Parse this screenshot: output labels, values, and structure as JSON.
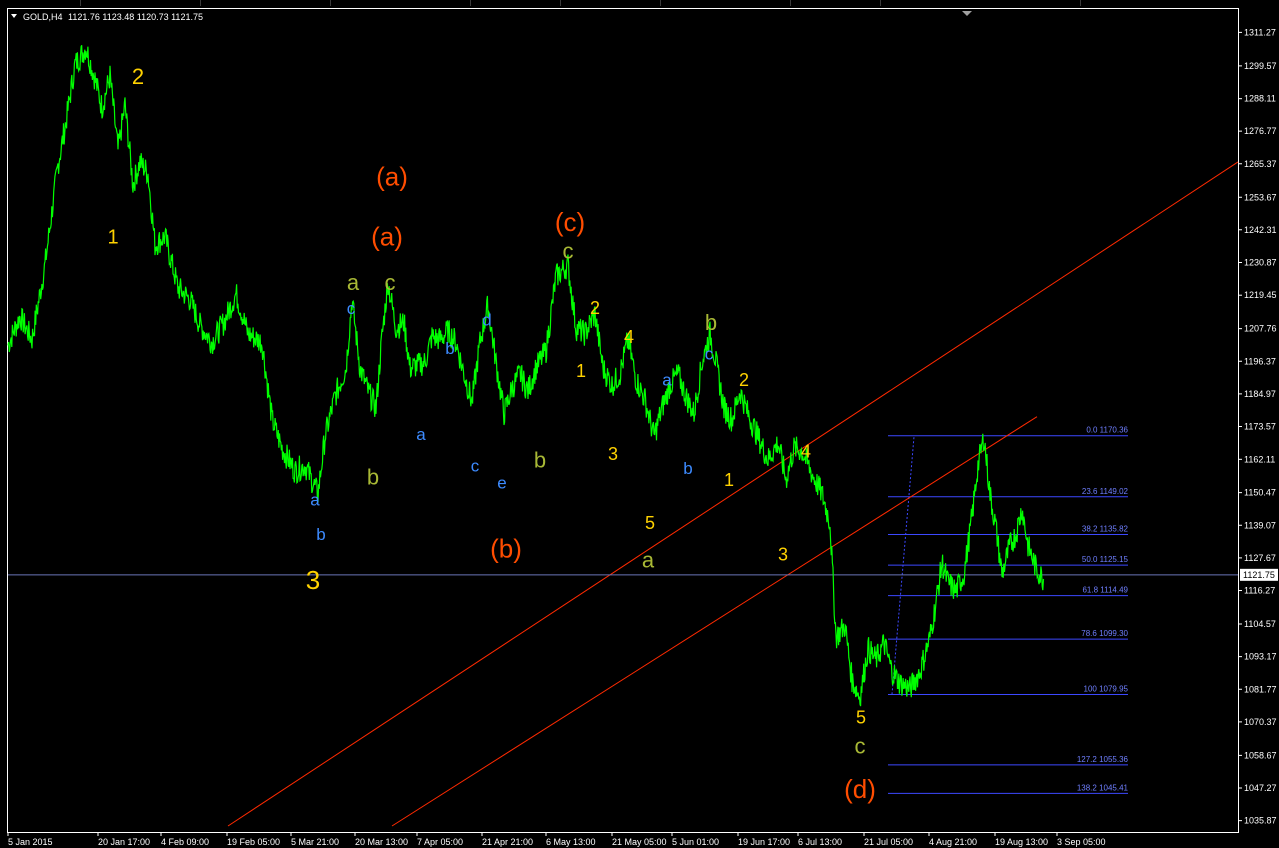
{
  "window": {
    "ticker_label": "GOLD,H4",
    "ohlc": "1121.76 1123.48 1120.73 1121.75",
    "current_price": "1121.75"
  },
  "colors": {
    "background": "#000000",
    "price_line": "#00ff00",
    "channel_line": "#ff2a00",
    "fib_line": "#3c48ff",
    "bid_line": "#6a75b8",
    "wave_yellow": "#ffd200",
    "wave_orange": "#ff4d00",
    "wave_olive": "#a8b835",
    "wave_blue": "#3d8bff"
  },
  "chart_data": {
    "type": "line",
    "instrument": "GOLD",
    "timeframe": "H4",
    "ylim": [
      1031.0,
      1316.0
    ],
    "xlim": [
      0,
      1232
    ],
    "y_ticks": [
      "1311.27",
      "1299.57",
      "1288.11",
      "1276.77",
      "1265.37",
      "1253.67",
      "1242.31",
      "1230.87",
      "1219.45",
      "1207.76",
      "1196.37",
      "1184.97",
      "1173.57",
      "1162.11",
      "1150.47",
      "1139.07",
      "1127.67",
      "1116.27",
      "1104.57",
      "1093.17",
      "1081.77",
      "1070.37",
      "1058.67",
      "1047.27",
      "1035.87"
    ],
    "x_ticks": [
      {
        "label": "5 Jan 2015",
        "x": 8
      },
      {
        "label": "20 Jan 17:00",
        "x": 98
      },
      {
        "label": "4 Feb 09:00",
        "x": 161
      },
      {
        "label": "19 Feb 05:00",
        "x": 227
      },
      {
        "label": "5 Mar 21:00",
        "x": 291
      },
      {
        "label": "20 Mar 13:00",
        "x": 355
      },
      {
        "label": "7 Apr 05:00",
        "x": 417
      },
      {
        "label": "21 Apr 21:00",
        "x": 482
      },
      {
        "label": "6 May 13:00",
        "x": 546
      },
      {
        "label": "21 May 05:00",
        "x": 612
      },
      {
        "label": "5 Jun 01:00",
        "x": 672
      },
      {
        "label": "19 Jun 17:00",
        "x": 738
      },
      {
        "label": "6 Jul 13:00",
        "x": 798
      },
      {
        "label": "21 Jul 05:00",
        "x": 864
      },
      {
        "label": "4 Aug 21:00",
        "x": 929
      },
      {
        "label": "19 Aug 13:00",
        "x": 995
      },
      {
        "label": "3 Sep 05:00",
        "x": 1057
      }
    ],
    "series": [
      {
        "points": [
          [
            8,
            1202
          ],
          [
            20,
            1212
          ],
          [
            32,
            1204
          ],
          [
            45,
            1230
          ],
          [
            58,
            1265
          ],
          [
            66,
            1280
          ],
          [
            75,
            1300
          ],
          [
            86,
            1306
          ],
          [
            95,
            1295
          ],
          [
            102,
            1285
          ],
          [
            110,
            1296
          ],
          [
            118,
            1270
          ],
          [
            125,
            1286
          ],
          [
            133,
            1258
          ],
          [
            140,
            1266
          ],
          [
            148,
            1262
          ],
          [
            155,
            1237
          ],
          [
            165,
            1240
          ],
          [
            178,
            1222
          ],
          [
            190,
            1218
          ],
          [
            200,
            1209
          ],
          [
            212,
            1203
          ],
          [
            224,
            1210
          ],
          [
            236,
            1220
          ],
          [
            248,
            1206
          ],
          [
            262,
            1203
          ],
          [
            272,
            1176
          ],
          [
            282,
            1166
          ],
          [
            295,
            1158
          ],
          [
            305,
            1160
          ],
          [
            318,
            1150
          ],
          [
            325,
            1170
          ],
          [
            335,
            1184
          ],
          [
            346,
            1194
          ],
          [
            352,
            1218
          ],
          [
            360,
            1194
          ],
          [
            368,
            1186
          ],
          [
            376,
            1180
          ],
          [
            382,
            1205
          ],
          [
            388,
            1224
          ],
          [
            396,
            1208
          ],
          [
            404,
            1210
          ],
          [
            410,
            1194
          ],
          [
            418,
            1195
          ],
          [
            425,
            1196
          ],
          [
            432,
            1205
          ],
          [
            440,
            1204
          ],
          [
            448,
            1207
          ],
          [
            456,
            1203
          ],
          [
            464,
            1192
          ],
          [
            472,
            1182
          ],
          [
            480,
            1203
          ],
          [
            488,
            1216
          ],
          [
            496,
            1196
          ],
          [
            504,
            1178
          ],
          [
            512,
            1187
          ],
          [
            520,
            1192
          ],
          [
            528,
            1186
          ],
          [
            536,
            1194
          ],
          [
            546,
            1200
          ],
          [
            556,
            1226
          ],
          [
            568,
            1230
          ],
          [
            576,
            1208
          ],
          [
            585,
            1206
          ],
          [
            595,
            1213
          ],
          [
            603,
            1194
          ],
          [
            612,
            1188
          ],
          [
            620,
            1192
          ],
          [
            628,
            1204
          ],
          [
            636,
            1190
          ],
          [
            645,
            1183
          ],
          [
            654,
            1170
          ],
          [
            662,
            1180
          ],
          [
            670,
            1188
          ],
          [
            678,
            1192
          ],
          [
            686,
            1184
          ],
          [
            694,
            1178
          ],
          [
            702,
            1196
          ],
          [
            710,
            1206
          ],
          [
            716,
            1196
          ],
          [
            724,
            1180
          ],
          [
            732,
            1176
          ],
          [
            740,
            1186
          ],
          [
            748,
            1178
          ],
          [
            758,
            1170
          ],
          [
            768,
            1162
          ],
          [
            778,
            1168
          ],
          [
            786,
            1155
          ],
          [
            794,
            1166
          ],
          [
            802,
            1165
          ],
          [
            812,
            1157
          ],
          [
            822,
            1150
          ],
          [
            830,
            1140
          ],
          [
            836,
            1100
          ],
          [
            845,
            1104
          ],
          [
            852,
            1085
          ],
          [
            860,
            1079
          ],
          [
            868,
            1096
          ],
          [
            876,
            1092
          ],
          [
            884,
            1098
          ],
          [
            892,
            1088
          ],
          [
            900,
            1084
          ],
          [
            910,
            1082
          ],
          [
            920,
            1088
          ],
          [
            930,
            1100
          ],
          [
            936,
            1112
          ],
          [
            942,
            1126
          ],
          [
            948,
            1119
          ],
          [
            956,
            1116
          ],
          [
            964,
            1122
          ],
          [
            972,
            1142
          ],
          [
            978,
            1160
          ],
          [
            984,
            1170
          ],
          [
            990,
            1150
          ],
          [
            996,
            1138
          ],
          [
            1002,
            1122
          ],
          [
            1010,
            1132
          ],
          [
            1016,
            1136
          ],
          [
            1022,
            1145
          ],
          [
            1028,
            1132
          ],
          [
            1036,
            1124
          ],
          [
            1044,
            1120
          ]
        ]
      }
    ],
    "channel_lines": [
      {
        "from": [
          228,
          1034
        ],
        "to": [
          1238,
          1266
        ]
      },
      {
        "from": [
          392,
          1034
        ],
        "to": [
          1037,
          1177
        ]
      }
    ],
    "fib_anchor_line": {
      "from": [
        892,
        1080
      ],
      "to": [
        914,
        1170
      ]
    },
    "fib_levels": [
      {
        "label": "0.0 1170.36",
        "price": 1170.36
      },
      {
        "label": "23.6 1149.02",
        "price": 1149.02
      },
      {
        "label": "38.2 1135.82",
        "price": 1135.82
      },
      {
        "label": "50.0 1125.15",
        "price": 1125.15
      },
      {
        "label": "61.8 1114.49",
        "price": 1114.49
      },
      {
        "label": "78.6 1099.30",
        "price": 1099.3
      },
      {
        "label": "100 1079.95",
        "price": 1079.95
      },
      {
        "label": "127.2 1055.36",
        "price": 1055.36
      },
      {
        "label": "138.2 1045.41",
        "price": 1045.41
      }
    ],
    "fib_x_range": [
      888,
      1128
    ],
    "bid_price": 1121.75,
    "annotations": [
      {
        "text": "2",
        "x": 138,
        "price": 1296,
        "color": "yellow",
        "size": 22
      },
      {
        "text": "1",
        "x": 113,
        "price": 1240,
        "color": "yellow",
        "size": 20
      },
      {
        "text": "(a)",
        "x": 392,
        "price": 1261,
        "color": "orange",
        "size": 26
      },
      {
        "text": "(a)",
        "x": 387,
        "price": 1240,
        "color": "orange",
        "size": 26
      },
      {
        "text": "a",
        "x": 353,
        "price": 1224,
        "color": "olive",
        "size": 22
      },
      {
        "text": "c",
        "x": 390,
        "price": 1224,
        "color": "olive",
        "size": 22
      },
      {
        "text": "c",
        "x": 351,
        "price": 1215,
        "color": "blue",
        "size": 17
      },
      {
        "text": "b",
        "x": 373,
        "price": 1156,
        "color": "olive",
        "size": 22
      },
      {
        "text": "a",
        "x": 315,
        "price": 1148,
        "color": "blue",
        "size": 17
      },
      {
        "text": "b",
        "x": 321,
        "price": 1136,
        "color": "blue",
        "size": 17
      },
      {
        "text": "3",
        "x": 313,
        "price": 1120,
        "color": "yellow",
        "size": 26
      },
      {
        "text": "a",
        "x": 421,
        "price": 1171,
        "color": "blue",
        "size": 17
      },
      {
        "text": "b",
        "x": 450,
        "price": 1201,
        "color": "blue",
        "size": 17
      },
      {
        "text": "d",
        "x": 487,
        "price": 1211,
        "color": "blue",
        "size": 17
      },
      {
        "text": "c",
        "x": 475,
        "price": 1160,
        "color": "blue",
        "size": 17
      },
      {
        "text": "e",
        "x": 502,
        "price": 1154,
        "color": "blue",
        "size": 17
      },
      {
        "text": "(b)",
        "x": 506,
        "price": 1131,
        "color": "orange",
        "size": 26
      },
      {
        "text": "b",
        "x": 540,
        "price": 1162,
        "color": "olive",
        "size": 22
      },
      {
        "text": "(c)",
        "x": 570,
        "price": 1245,
        "color": "orange",
        "size": 26
      },
      {
        "text": "c",
        "x": 568,
        "price": 1235,
        "color": "olive",
        "size": 22
      },
      {
        "text": "2",
        "x": 595,
        "price": 1215,
        "color": "yellow",
        "size": 18
      },
      {
        "text": "1",
        "x": 581,
        "price": 1193,
        "color": "yellow",
        "size": 18
      },
      {
        "text": "4",
        "x": 629,
        "price": 1205,
        "color": "yellow",
        "size": 18
      },
      {
        "text": "3",
        "x": 613,
        "price": 1164,
        "color": "yellow",
        "size": 18
      },
      {
        "text": "5",
        "x": 650,
        "price": 1140,
        "color": "yellow",
        "size": 18
      },
      {
        "text": "a",
        "x": 648,
        "price": 1127,
        "color": "olive",
        "size": 22
      },
      {
        "text": "a",
        "x": 667,
        "price": 1190,
        "color": "blue",
        "size": 17
      },
      {
        "text": "b",
        "x": 688,
        "price": 1159,
        "color": "blue",
        "size": 17
      },
      {
        "text": "b",
        "x": 711,
        "price": 1210,
        "color": "olive",
        "size": 22
      },
      {
        "text": "c",
        "x": 709,
        "price": 1199,
        "color": "blue",
        "size": 17
      },
      {
        "text": "2",
        "x": 744,
        "price": 1190,
        "color": "yellow",
        "size": 18
      },
      {
        "text": "1",
        "x": 729,
        "price": 1155,
        "color": "yellow",
        "size": 18
      },
      {
        "text": "4",
        "x": 806,
        "price": 1165,
        "color": "yellow",
        "size": 18
      },
      {
        "text": "3",
        "x": 783,
        "price": 1129,
        "color": "yellow",
        "size": 18
      },
      {
        "text": "5",
        "x": 861,
        "price": 1072,
        "color": "yellow",
        "size": 18
      },
      {
        "text": "c",
        "x": 860,
        "price": 1062,
        "color": "olive",
        "size": 22
      },
      {
        "text": "(d)",
        "x": 860,
        "price": 1047,
        "color": "orange",
        "size": 26
      }
    ]
  }
}
